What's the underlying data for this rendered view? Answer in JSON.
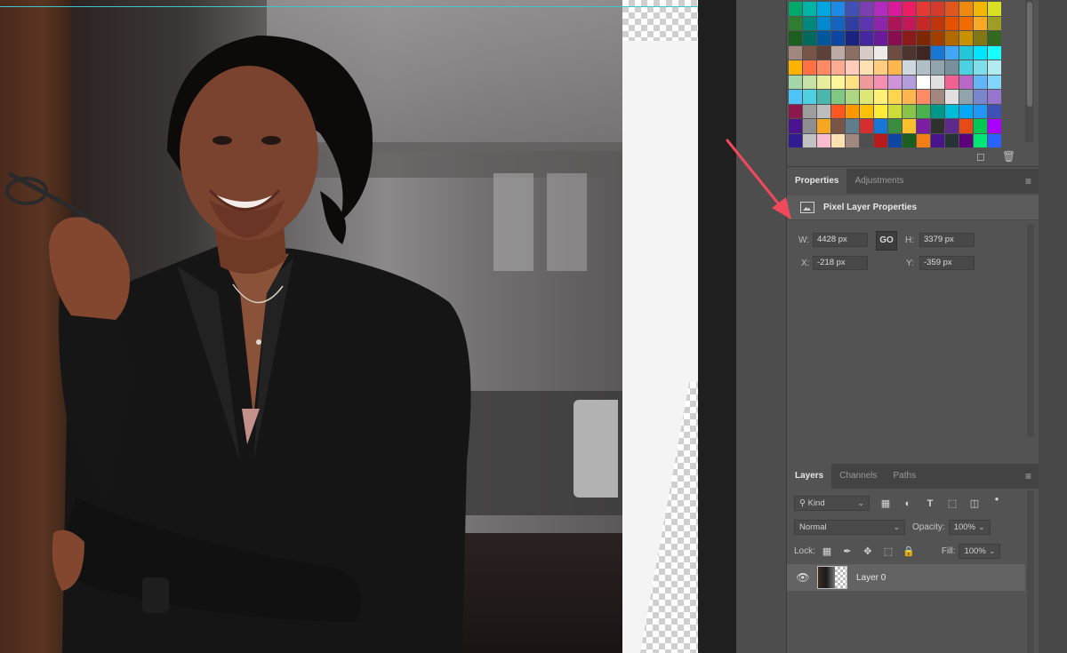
{
  "colors": {
    "accent_arrow": "#f0485c",
    "guide_line": "#3fc6cc",
    "panel_bg": "#535353",
    "tab_bar_bg": "#434343"
  },
  "swatches": {
    "colors": [
      "#00a86b",
      "#00b4a6",
      "#00a6e0",
      "#1e88e5",
      "#3f51b5",
      "#7a3fb0",
      "#b12bbf",
      "#d81b9a",
      "#e91e63",
      "#e53935",
      "#d33b2c",
      "#e0561f",
      "#f08a0f",
      "#f2b705",
      "#d9e021",
      "#2e7d32",
      "#00897b",
      "#0288d1",
      "#1565c0",
      "#303f9f",
      "#5e35b1",
      "#8e24aa",
      "#ad1457",
      "#c2185b",
      "#c62828",
      "#bf360c",
      "#e65100",
      "#ef6c00",
      "#f9a825",
      "#9e9d24",
      "#1b5e20",
      "#00695c",
      "#01579b",
      "#0d47a1",
      "#1a237e",
      "#4527a0",
      "#6a1b9a",
      "#880e4f",
      "#8b1a1a",
      "#7f2704",
      "#a04000",
      "#b26a00",
      "#c79100",
      "#827717",
      "#33691e",
      "#a1887f",
      "#795548",
      "#5d4037",
      "#bcaaa4",
      "#8d6e63",
      "#d7ccc8",
      "#efebe9",
      "#6d4c41",
      "#4e342e",
      "#3e2723",
      "#1976d2",
      "#42a5f5",
      "#26c6da",
      "#00e5ff",
      "#18ffff",
      "#ffb300",
      "#ff7043",
      "#ff8a65",
      "#ffab91",
      "#ffccbc",
      "#ffe0b2",
      "#ffcc80",
      "#ffb74d",
      "#cfd8dc",
      "#b0bec5",
      "#90a4ae",
      "#78909c",
      "#4dd0e1",
      "#80deea",
      "#b2ebf2",
      "#a5d6a7",
      "#c5e1a5",
      "#e6ee9c",
      "#fff59d",
      "#ffe082",
      "#ef9a9a",
      "#f48fb1",
      "#ce93d8",
      "#b39ddb",
      "#ffffff",
      "#e0e0e0",
      "#f06292",
      "#ba68c8",
      "#64b5f6",
      "#81d4fa",
      "#4fc3f7",
      "#4dd0e1",
      "#4db6ac",
      "#81c784",
      "#aed581",
      "#dce775",
      "#fff176",
      "#ffd54f",
      "#ffb74d",
      "#ff8a65",
      "#a1887f",
      "#e0e0e0",
      "#90a4ae",
      "#7986cb",
      "#9575cd",
      "#8b1a4a",
      "#9e9e9e",
      "#bdbdbd",
      "#ff5722",
      "#ff9800",
      "#ffc107",
      "#ffeb3b",
      "#cddc39",
      "#8bc34a",
      "#4caf50",
      "#009688",
      "#00bcd4",
      "#03a9f4",
      "#2196f3",
      "#3f51b5",
      "#4a148c",
      "#8e8e8e",
      "#f5a623",
      "#795548",
      "#607d8b",
      "#d32f2f",
      "#1976d2",
      "#388e3c",
      "#fbc02d",
      "#7b1fa2",
      "#303030",
      "#5d2a8c",
      "#e64a19",
      "#00c853",
      "#aa00ff",
      "#311b92",
      "#c2c2c2",
      "#f8bbd0",
      "#ffe0b2",
      "#a1887f",
      "#4e4e4e",
      "#b71c1c",
      "#0d47a1",
      "#1b5e20",
      "#f57f17",
      "#4a148c",
      "#263238",
      "#5c007a",
      "#00e676",
      "#2962ff"
    ],
    "new_swatch_icon": "new-swatch-icon",
    "delete_icon": "trash-icon"
  },
  "properties": {
    "tabs": [
      {
        "label": "Properties",
        "active": true
      },
      {
        "label": "Adjustments",
        "active": false
      }
    ],
    "header_title": "Pixel Layer Properties",
    "w_label": "W:",
    "w_value": "4428 px",
    "h_label": "H:",
    "h_value": "3379 px",
    "x_label": "X:",
    "x_value": "-218 px",
    "y_label": "Y:",
    "y_value": "-359 px",
    "link_symbol": "GO"
  },
  "layers": {
    "tabs": [
      {
        "label": "Layers",
        "active": true
      },
      {
        "label": "Channels",
        "active": false
      },
      {
        "label": "Paths",
        "active": false
      }
    ],
    "filter_kind": "Kind",
    "blend_mode": "Normal",
    "opacity_label": "Opacity:",
    "opacity_value": "100%",
    "lock_label": "Lock:",
    "fill_label": "Fill:",
    "fill_value": "100%",
    "layer_name": "Layer 0"
  },
  "menu_symbol": "≡"
}
